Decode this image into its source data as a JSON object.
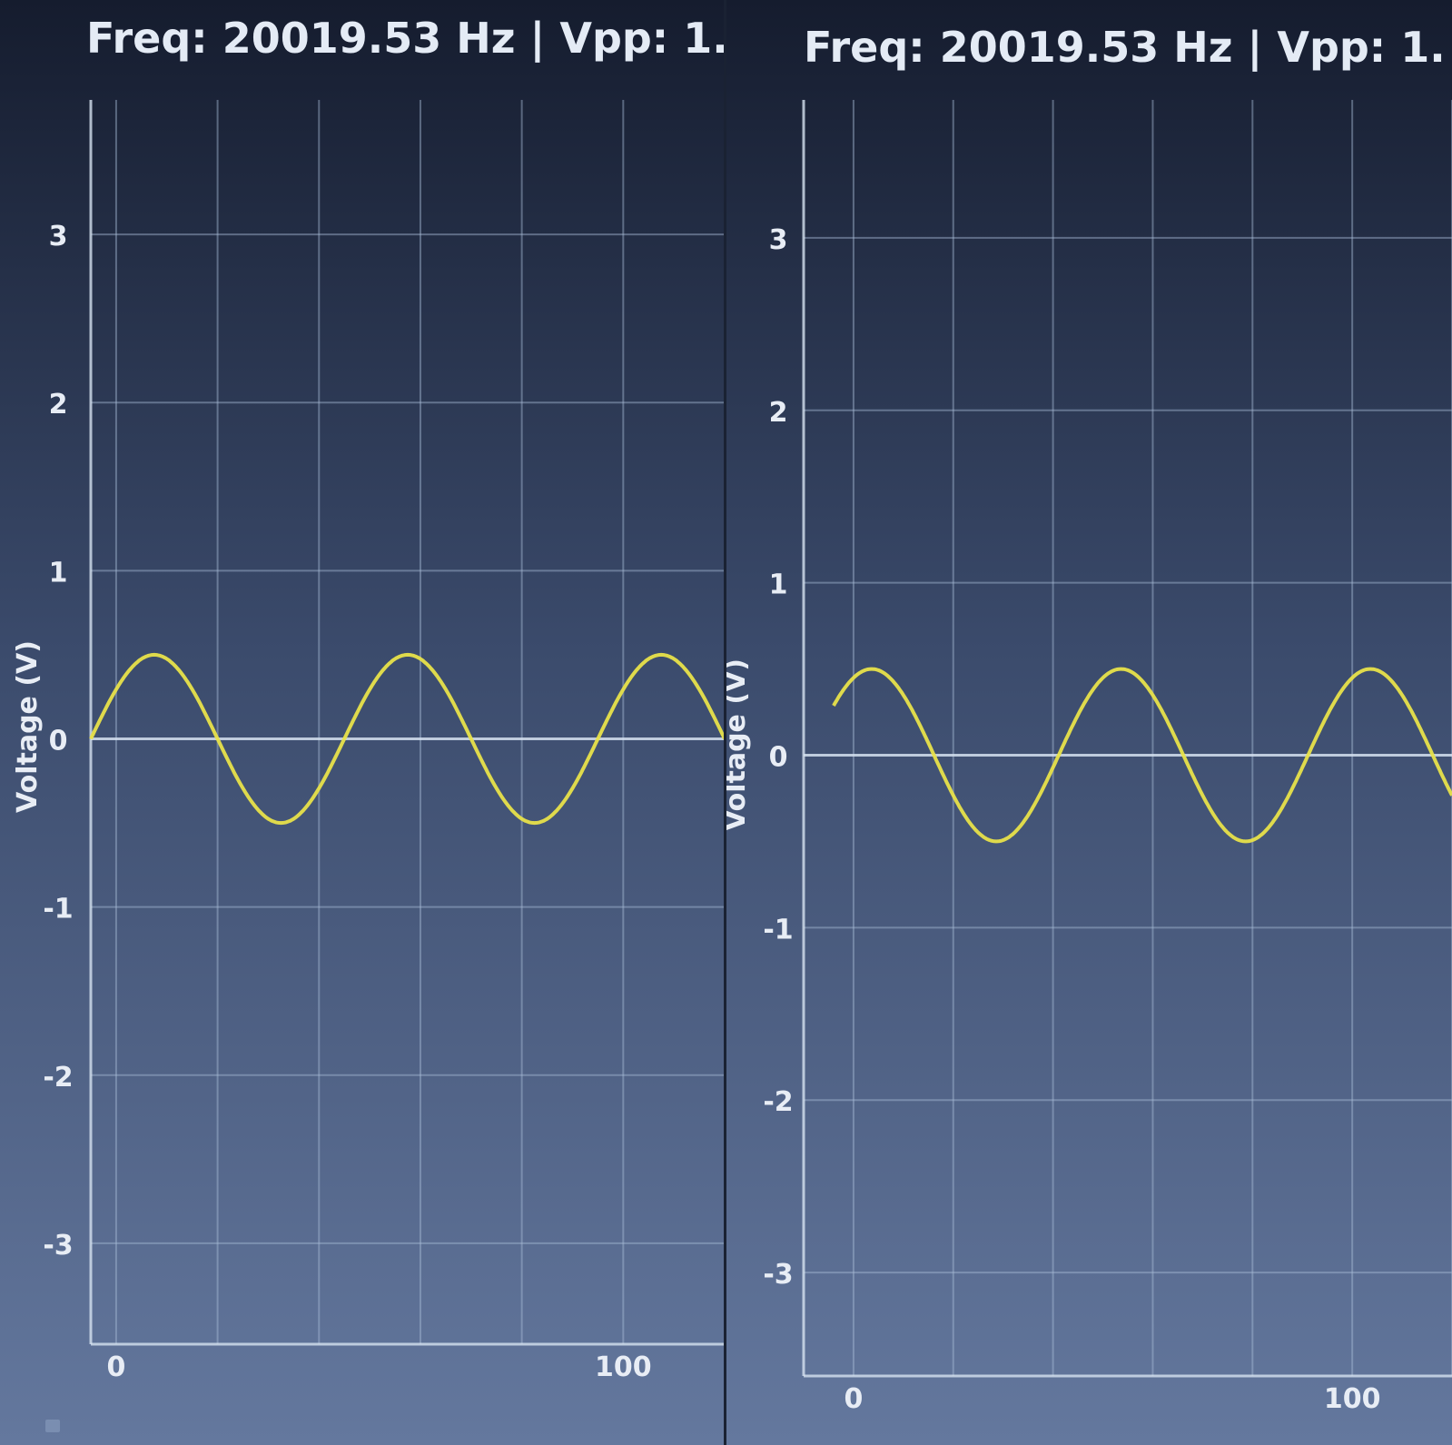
{
  "app": {
    "corner_icon": "window-indicator-icon"
  },
  "colors": {
    "background_top": "#151c2e",
    "background_bottom": "#64789e",
    "grid": "#a9bdd6",
    "axis": "#d6e2f0",
    "trace": "#e8e24a",
    "text": "#e8edf5"
  },
  "chart_data": [
    {
      "type": "line",
      "title": "Freq: 20019.53 Hz | Vpp: 1.",
      "ylabel": "Voltage (V)",
      "xlabel": "",
      "xlim": [
        -5,
        120
      ],
      "ylim": [
        -3.6,
        3.8
      ],
      "xticks": [
        {
          "value": 0,
          "label": "0"
        },
        {
          "value": 100,
          "label": "100"
        }
      ],
      "yticks": [
        {
          "value": 3,
          "label": "3"
        },
        {
          "value": 2,
          "label": "2"
        },
        {
          "value": 1,
          "label": "1"
        },
        {
          "value": 0,
          "label": "0"
        },
        {
          "value": -1,
          "label": "-1"
        },
        {
          "value": -2,
          "label": "-2"
        },
        {
          "value": -3,
          "label": "-3"
        }
      ],
      "grid": true,
      "series": [
        {
          "amplitude": 0.5,
          "period_samples": 50,
          "phase_deg": 0,
          "x_start": -5,
          "x_end": 120
        }
      ]
    },
    {
      "type": "line",
      "title": "Freq: 20019.53 Hz | Vpp: 1.",
      "ylabel": "Voltage (V)",
      "xlabel": "",
      "xlim": [
        -10,
        120
      ],
      "ylim": [
        -3.6,
        3.8
      ],
      "xticks": [
        {
          "value": 0,
          "label": "0"
        },
        {
          "value": 100,
          "label": "100"
        }
      ],
      "yticks": [
        {
          "value": 3,
          "label": "3"
        },
        {
          "value": 2,
          "label": "2"
        },
        {
          "value": 1,
          "label": "1"
        },
        {
          "value": 0,
          "label": "0"
        },
        {
          "value": -1,
          "label": "-1"
        },
        {
          "value": -2,
          "label": "-2"
        },
        {
          "value": -3,
          "label": "-3"
        }
      ],
      "grid": true,
      "series": [
        {
          "amplitude": 0.5,
          "period_samples": 50,
          "phase_deg": 35,
          "x_start": -4,
          "x_end": 120
        }
      ]
    }
  ]
}
